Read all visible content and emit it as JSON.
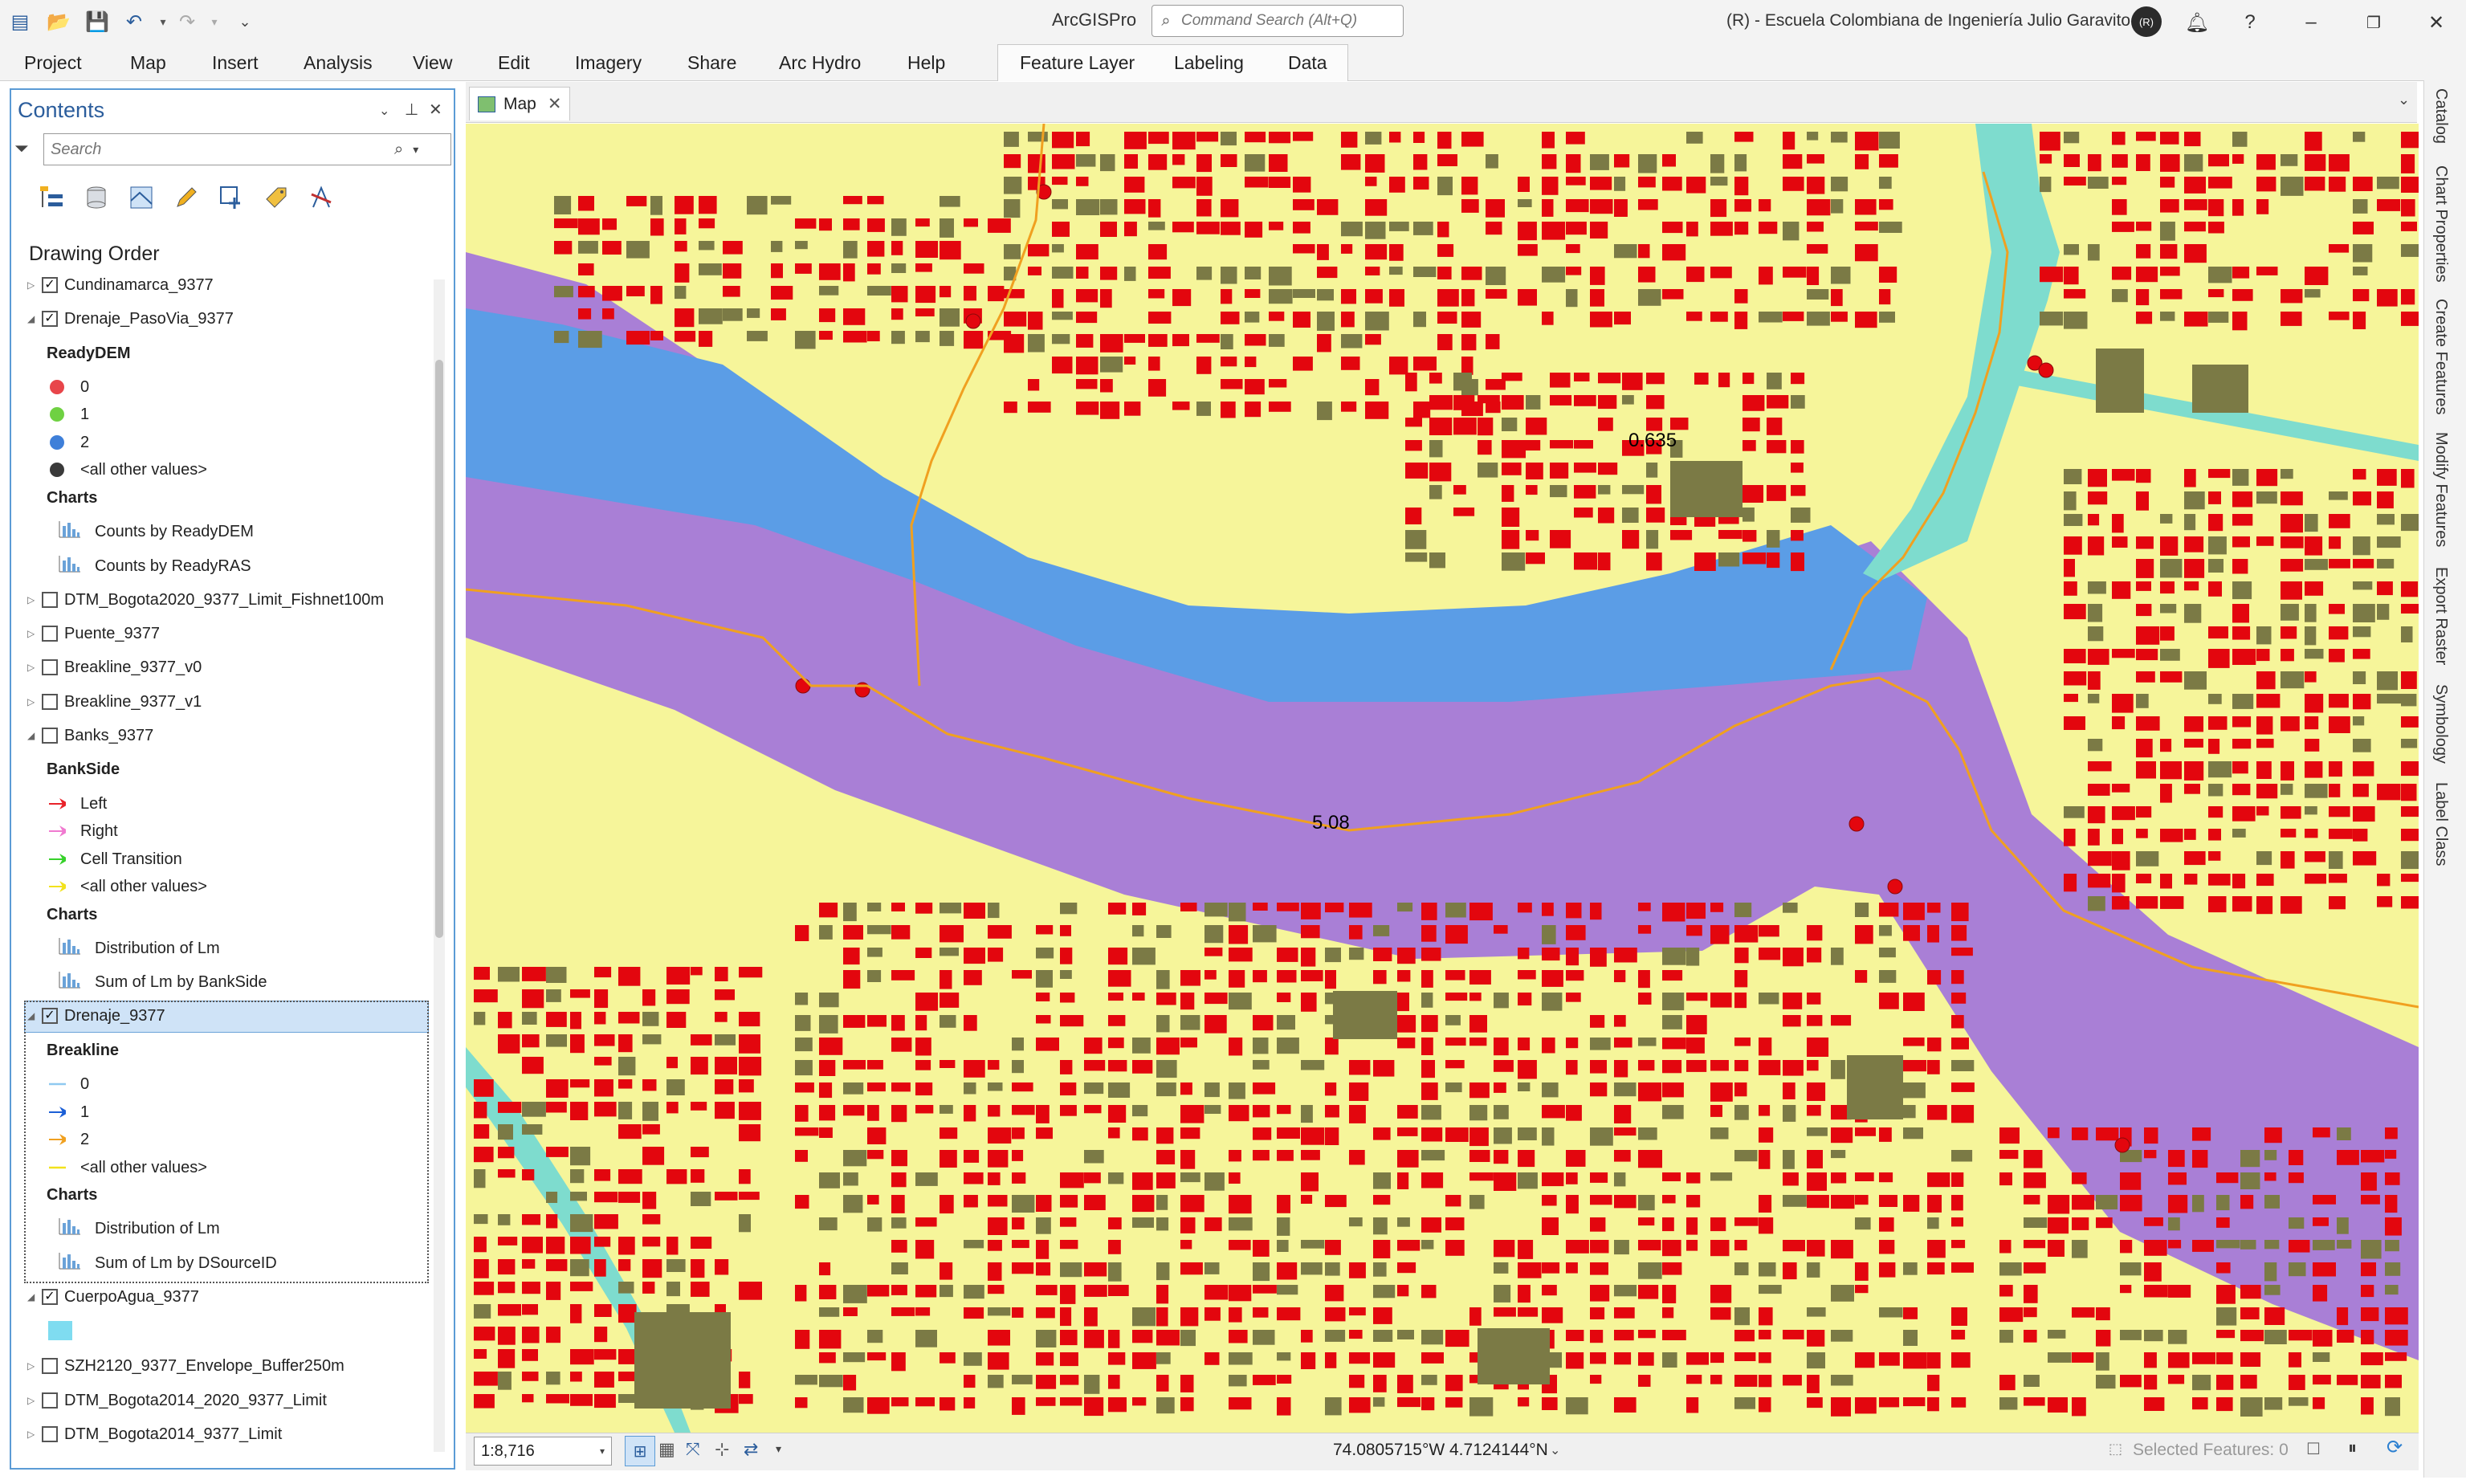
{
  "app": {
    "title": "ArcGISPro",
    "organization": "(R) - Escuela Colombiana de Ingeniería Julio Garavito",
    "avatar_initials": "(R)",
    "command_search_placeholder": "Command Search (Alt+Q)"
  },
  "ribbon": {
    "tabs": [
      "Project",
      "Map",
      "Insert",
      "Analysis",
      "View",
      "Edit",
      "Imagery",
      "Share",
      "Arc Hydro",
      "Help"
    ],
    "contextual_tabs": [
      "Feature Layer",
      "Labeling",
      "Data"
    ]
  },
  "contents": {
    "title": "Contents",
    "search_placeholder": "Search",
    "section": "Drawing Order",
    "rows": [
      {
        "kind": "layer",
        "label": "Cundinamarca_9377",
        "checked": true,
        "expanded": false
      },
      {
        "kind": "layer",
        "label": "Drenaje_PasoVia_9377",
        "checked": true,
        "expanded": true
      },
      {
        "kind": "head",
        "label": "ReadyDEM"
      },
      {
        "kind": "sym",
        "label": "0",
        "symbol": "dot",
        "color": "#e8454a"
      },
      {
        "kind": "sym",
        "label": "1",
        "symbol": "dot",
        "color": "#6fd142"
      },
      {
        "kind": "sym",
        "label": "2",
        "symbol": "dot",
        "color": "#3e7fd9"
      },
      {
        "kind": "sym",
        "label": "<all other values>",
        "symbol": "dot",
        "color": "#3a3a3a"
      },
      {
        "kind": "head",
        "label": "Charts"
      },
      {
        "kind": "chart",
        "label": "Counts by ReadyDEM"
      },
      {
        "kind": "chart",
        "label": "Counts by ReadyRAS"
      },
      {
        "kind": "layer",
        "label": "DTM_Bogota2020_9377_Limit_Fishnet100m",
        "checked": false,
        "expanded": false
      },
      {
        "kind": "layer",
        "label": "Puente_9377",
        "checked": false,
        "expanded": false
      },
      {
        "kind": "layer",
        "label": "Breakline_9377_v0",
        "checked": false,
        "expanded": false
      },
      {
        "kind": "layer",
        "label": "Breakline_9377_v1",
        "checked": false,
        "expanded": false
      },
      {
        "kind": "layer",
        "label": "Banks_9377",
        "checked": false,
        "expanded": true
      },
      {
        "kind": "head",
        "label": "BankSide"
      },
      {
        "kind": "sym",
        "label": "Left",
        "symbol": "arrow",
        "color": "#e8232a"
      },
      {
        "kind": "sym",
        "label": "Right",
        "symbol": "arrow",
        "color": "#f07ad0"
      },
      {
        "kind": "sym",
        "label": "Cell Transition",
        "symbol": "arrow",
        "color": "#36d12a"
      },
      {
        "kind": "sym",
        "label": "<all other values>",
        "symbol": "arrow",
        "color": "#f2e21c"
      },
      {
        "kind": "head",
        "label": "Charts"
      },
      {
        "kind": "chart",
        "label": "Distribution of Lm"
      },
      {
        "kind": "chart",
        "label": "Sum of Lm by BankSide"
      },
      {
        "kind": "layer",
        "label": "Drenaje_9377",
        "checked": true,
        "expanded": true,
        "selected": true
      },
      {
        "kind": "head",
        "label": "Breakline"
      },
      {
        "kind": "sym",
        "label": "0",
        "symbol": "line",
        "color": "#8fc9f0"
      },
      {
        "kind": "sym",
        "label": "1",
        "symbol": "arrow",
        "color": "#1c5fd6"
      },
      {
        "kind": "sym",
        "label": "2",
        "symbol": "arrow",
        "color": "#f0a020"
      },
      {
        "kind": "sym",
        "label": "<all other values>",
        "symbol": "line",
        "color": "#f2e21c"
      },
      {
        "kind": "head",
        "label": "Charts"
      },
      {
        "kind": "chart",
        "label": "Distribution of Lm"
      },
      {
        "kind": "chart",
        "label": "Sum of Lm by DSourceID"
      },
      {
        "kind": "layer",
        "label": "CuerpoAgua_9377",
        "checked": true,
        "expanded": true
      },
      {
        "kind": "sym",
        "label": "",
        "symbol": "box",
        "color": "#7fdcf0"
      },
      {
        "kind": "layer",
        "label": "SZH2120_9377_Envelope_Buffer250m",
        "checked": false,
        "expanded": false
      },
      {
        "kind": "layer",
        "label": "DTM_Bogota2014_2020_9377_Limit",
        "checked": false,
        "expanded": false
      },
      {
        "kind": "layer",
        "label": "DTM_Bogota2014_9377_Limit",
        "checked": false,
        "expanded": false
      }
    ]
  },
  "map": {
    "tab_label": "Map",
    "labels": [
      "0.635",
      "5.08"
    ],
    "colors": {
      "land": "#f6f59a",
      "buffer": "#a97fd6",
      "water": "#5b9de6",
      "channel": "#7edcce",
      "building": "#7b7a45",
      "point": "#e3060e",
      "stream": "#f0a020"
    }
  },
  "status": {
    "scale": "1:8,716",
    "coordinates": "74.0805715°W 4.7124144°N",
    "selected_features": "Selected Features: 0"
  },
  "side_panes": [
    "Catalog",
    "Chart Properties",
    "Create Features",
    "Modify Features",
    "Export Raster",
    "Symbology",
    "Label Class"
  ]
}
